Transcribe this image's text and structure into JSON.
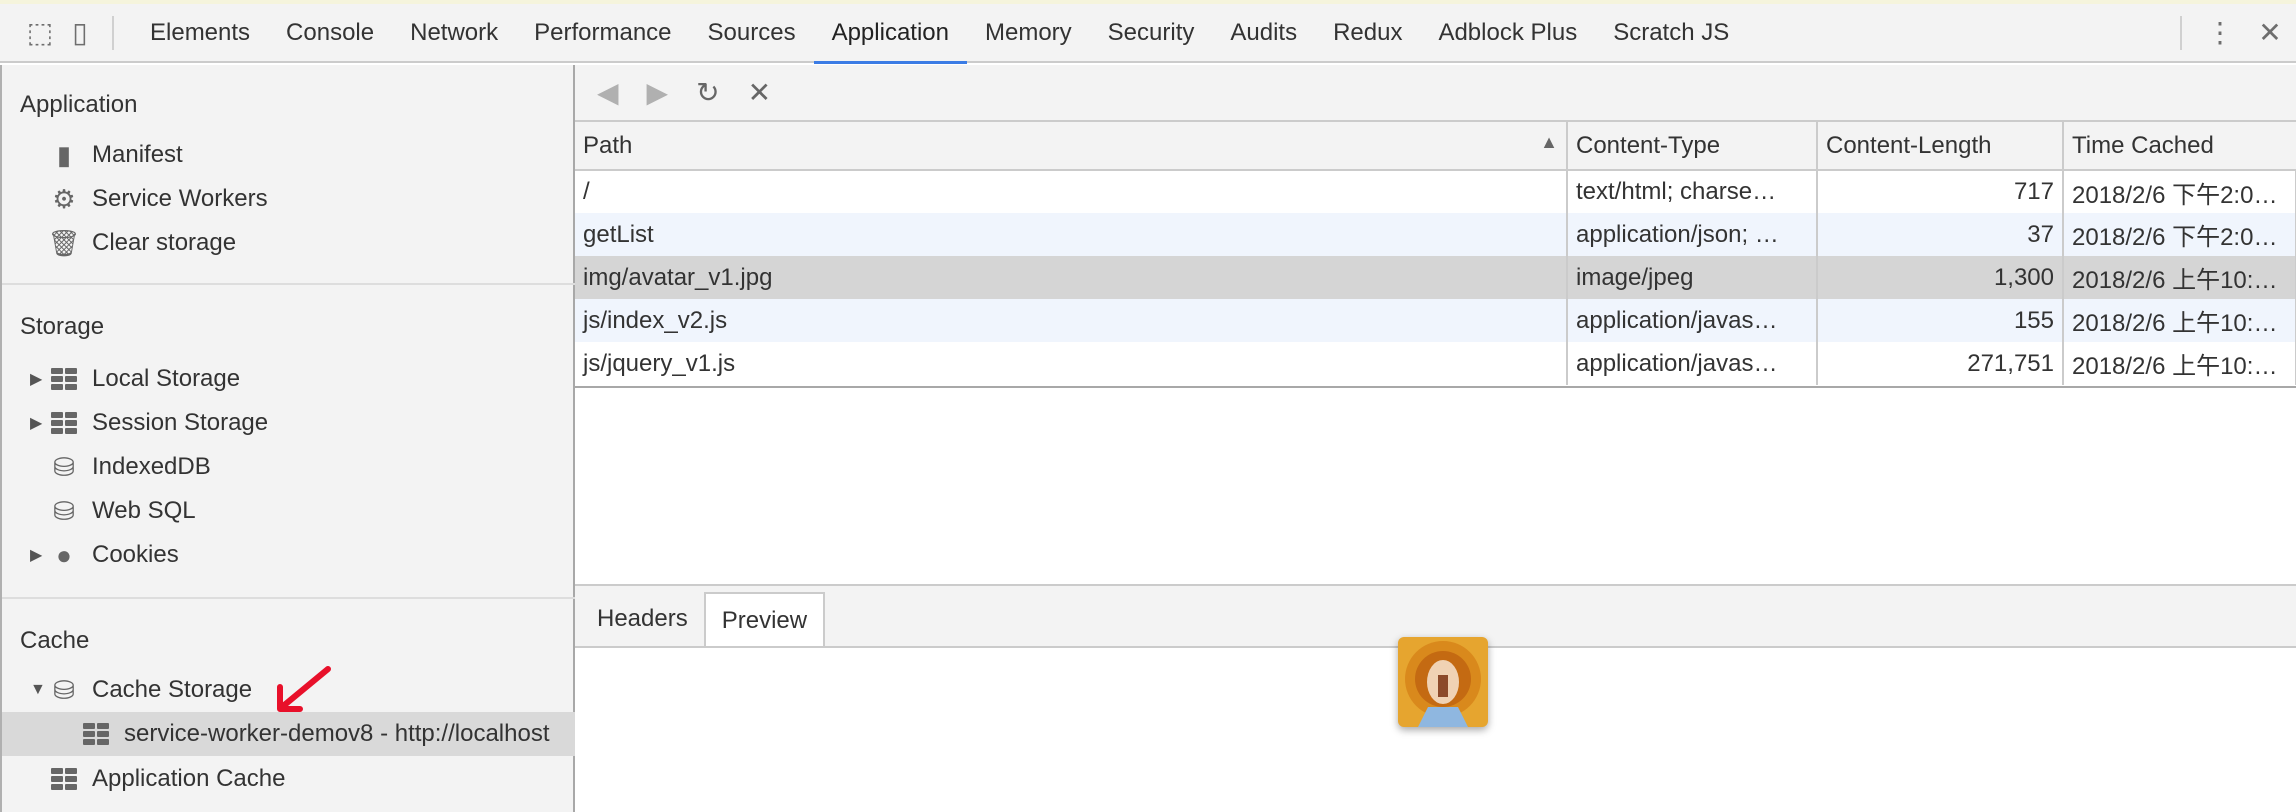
{
  "tabs": [
    "Elements",
    "Console",
    "Network",
    "Performance",
    "Sources",
    "Application",
    "Memory",
    "Security",
    "Audits",
    "Redux",
    "Adblock Plus",
    "Scratch JS"
  ],
  "active_tab": "Application",
  "sidebar": {
    "application": {
      "title": "Application",
      "items": [
        "Manifest",
        "Service Workers",
        "Clear storage"
      ]
    },
    "storage": {
      "title": "Storage",
      "items": [
        "Local Storage",
        "Session Storage",
        "IndexedDB",
        "Web SQL",
        "Cookies"
      ]
    },
    "cache": {
      "title": "Cache",
      "items": [
        "Cache Storage",
        "service-worker-demov8 - http://localhost",
        "Application Cache"
      ]
    }
  },
  "table": {
    "headers": [
      "Path",
      "Content-Type",
      "Content-Length",
      "Time Cached"
    ],
    "rows": [
      [
        "/",
        "text/html; charse…",
        "717",
        "2018/2/6 下午2:0…"
      ],
      [
        "getList",
        "application/json; …",
        "37",
        "2018/2/6 下午2:0…"
      ],
      [
        "img/avatar_v1.jpg",
        "image/jpeg",
        "1,300",
        "2018/2/6 上午10:…"
      ],
      [
        "js/index_v2.js",
        "application/javas…",
        "155",
        "2018/2/6 上午10:…"
      ],
      [
        "js/jquery_v1.js",
        "application/javas…",
        "271,751",
        "2018/2/6 上午10:…"
      ]
    ]
  },
  "detail_tabs": [
    "Headers",
    "Preview"
  ],
  "colors": {
    "accent": "#3b7ce5",
    "annotation_arrow": "#e8102a"
  }
}
